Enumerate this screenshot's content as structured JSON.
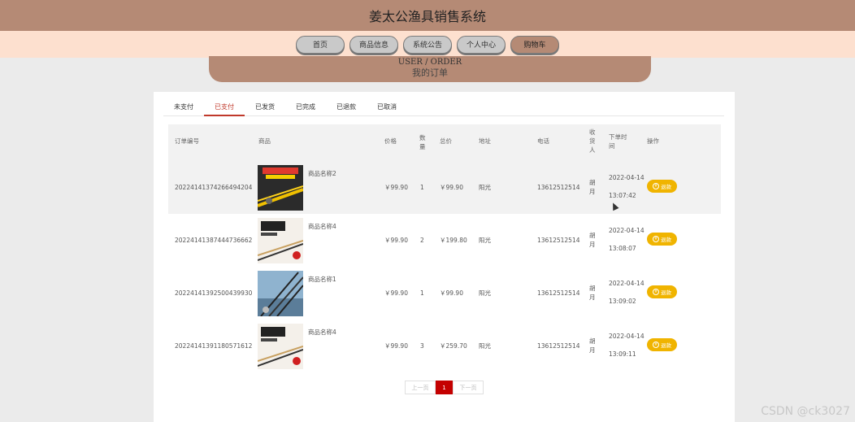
{
  "app": {
    "title": "姜太公渔具销售系统"
  },
  "nav": [
    {
      "label": "首页",
      "active": false
    },
    {
      "label": "商品信息",
      "active": false
    },
    {
      "label": "系统公告",
      "active": false
    },
    {
      "label": "个人中心",
      "active": false
    },
    {
      "label": "购物车",
      "active": true
    }
  ],
  "banner": {
    "en": "USER / ORDER",
    "cn": "我的订单"
  },
  "tabs": [
    {
      "label": "未支付",
      "active": false
    },
    {
      "label": "已支付",
      "active": true
    },
    {
      "label": "已发货",
      "active": false
    },
    {
      "label": "已完成",
      "active": false
    },
    {
      "label": "已退款",
      "active": false
    },
    {
      "label": "已取消",
      "active": false
    }
  ],
  "table": {
    "headers": {
      "order_no": "订单编号",
      "product": "商品",
      "price": "价格",
      "qty": "数量",
      "total": "总价",
      "address": "地址",
      "phone": "电话",
      "receiver": "收货人",
      "time": "下单时间",
      "action": "操作"
    },
    "rows": [
      {
        "order_no": "20224141374266494204",
        "product": "商品名称2",
        "price": "￥99.90",
        "qty": "1",
        "total": "￥99.90",
        "address": "阳光",
        "phone": "13612512514",
        "receiver": "胡月",
        "date": "2022-04-14",
        "time": "13:07:42",
        "action": "退款",
        "image": "rod-yellow"
      },
      {
        "order_no": "20224141387444736662",
        "product": "商品名称4",
        "price": "￥99.90",
        "qty": "2",
        "total": "￥199.80",
        "address": "阳光",
        "phone": "13612512514",
        "receiver": "胡月",
        "date": "2022-04-14",
        "time": "13:08:07",
        "action": "退款",
        "image": "rod-poster"
      },
      {
        "order_no": "20224141392500439930",
        "product": "商品名称1",
        "price": "￥99.90",
        "qty": "1",
        "total": "￥99.90",
        "address": "阳光",
        "phone": "13612512514",
        "receiver": "胡月",
        "date": "2022-04-14",
        "time": "13:09:02",
        "action": "退款",
        "image": "rods-sea"
      },
      {
        "order_no": "20224141391180571612",
        "product": "商品名称4",
        "price": "￥99.90",
        "qty": "3",
        "total": "￥259.70",
        "address": "阳光",
        "phone": "13612512514",
        "receiver": "胡月",
        "date": "2022-04-14",
        "time": "13:09:11",
        "action": "退款",
        "image": "rod-poster"
      }
    ]
  },
  "pager": {
    "prev": "上一页",
    "current": "1",
    "next": "下一页"
  },
  "watermark": "CSDN @ck3027",
  "colors": {
    "header_bg": "#b58a75",
    "nav_bg": "#fde0cf",
    "accent_red": "#c40000",
    "pay_button": "#f0b400"
  }
}
